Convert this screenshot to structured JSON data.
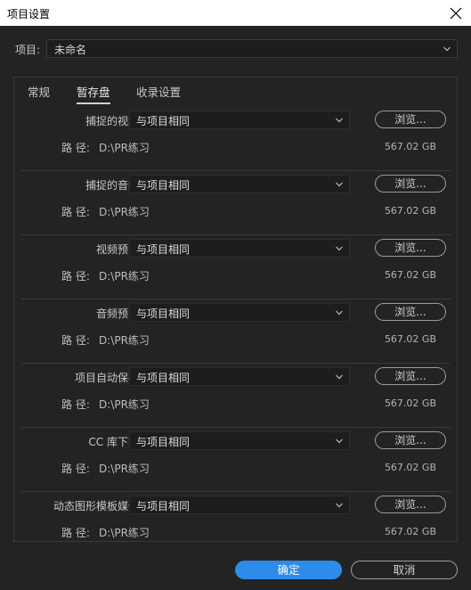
{
  "window": {
    "title": "项目设置"
  },
  "project": {
    "label": "项目:",
    "value": "未命名"
  },
  "tabs": [
    {
      "label": "常规"
    },
    {
      "label": "暂存盘"
    },
    {
      "label": "收录设置"
    }
  ],
  "rows": [
    {
      "label": "捕捉的视频:",
      "value": "与项目相同",
      "browse": "浏览...",
      "path_label": "路 径:",
      "path": "D:\\PR练习",
      "size": "567.02 GB"
    },
    {
      "label": "捕捉的音频:",
      "value": "与项目相同",
      "browse": "浏览...",
      "path_label": "路 径:",
      "path": "D:\\PR练习",
      "size": "567.02 GB"
    },
    {
      "label": "视频预览:",
      "value": "与项目相同",
      "browse": "浏览...",
      "path_label": "路 径:",
      "path": "D:\\PR练习",
      "size": "567.02 GB"
    },
    {
      "label": "音频预览:",
      "value": "与项目相同",
      "browse": "浏览...",
      "path_label": "路 径:",
      "path": "D:\\PR练习",
      "size": "567.02 GB"
    },
    {
      "label": "项目自动保存:",
      "value": "与项目相同",
      "browse": "浏览...",
      "path_label": "路 径:",
      "path": "D:\\PR练习",
      "size": "567.02 GB"
    },
    {
      "label": "CC 库下载:",
      "value": "与项目相同",
      "browse": "浏览...",
      "path_label": "路 径:",
      "path": "D:\\PR练习",
      "size": "567.02 GB"
    },
    {
      "label": "动态图形模板媒体:",
      "value": "与项目相同",
      "browse": "浏览...",
      "path_label": "路 径:",
      "path": "D:\\PR练习",
      "size": "567.02 GB"
    }
  ],
  "buttons": {
    "ok": "确定",
    "cancel": "取消"
  },
  "colors": {
    "accent": "#2d8ceb",
    "background": "#232323",
    "field": "#1d1d1d"
  }
}
